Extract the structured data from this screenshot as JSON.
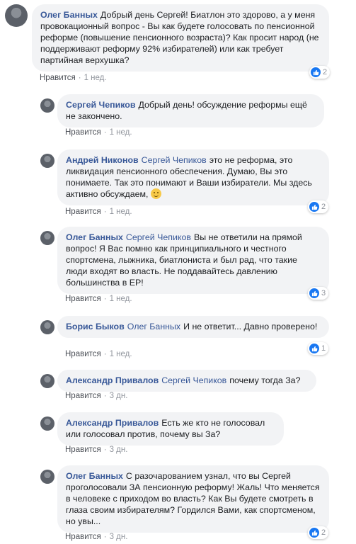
{
  "like_label": "Нравится",
  "comments": [
    {
      "author": "Олег Банных",
      "mention": "",
      "text": "Добрый день Сергей! Биатлон это здорово, а у меня провокационный вопрос - Вы как будете голосовать по пенсионной реформе (повышение пенсионного возраста)? Как просит народ (не поддерживают реформу 92% избирателей) или как требует партийная верхушка?",
      "time": "1 нед.",
      "reactions": "2"
    },
    {
      "author": "Сергей Чепиков",
      "mention": "",
      "text": "Добрый день! обсуждение реформы ещё не закончено.",
      "time": "1 нед.",
      "reactions": ""
    },
    {
      "author": "Андрей Никонов",
      "mention": "Сергей Чепиков",
      "text": "это не реформа, это ликвидация пенсионного обеспечения. Думаю, Вы это понимаете. Так это понимают и Ваши избиратели. Мы здесь активно обсуждаем,",
      "time": "1 нед.",
      "reactions": "2"
    },
    {
      "author": "Олег Банных",
      "mention": "Сергей Чепиков",
      "text": "Вы не ответили на прямой вопрос! Я Вас помню как принципиального и честного спортсмена, лыжника, биатлониста и был рад, что такие люди входят во власть. Не поддавайтесь давлению большинства в ЕР!",
      "time": "1 нед.",
      "reactions": "3"
    },
    {
      "author": "Борис Быков",
      "mention": "Олег Банных",
      "text": "И не ответит... Давно проверено!",
      "time": "1 нед.",
      "reactions": "1"
    },
    {
      "author": "Александр Привалов",
      "mention": "Сергей Чепиков",
      "text": "почему тогда За?",
      "time": "3 дн.",
      "reactions": ""
    },
    {
      "author": "Александр Привалов",
      "mention": "",
      "text": "Есть же кто не голосовал или голосовал против, почему вы За?",
      "time": "3 дн.",
      "reactions": ""
    },
    {
      "author": "Олег Банных",
      "mention": "",
      "text": "С разочарованием узнал, что вы Сергей проголосовали ЗА пенсионную реформу! Жаль! Что меняется в человеке с приходом во власть? Как Вы будете смотреть в глаза своим избирателям? Гордился Вами, как спортсменом, но увы...",
      "time": "3 дн.",
      "reactions": "2"
    }
  ]
}
